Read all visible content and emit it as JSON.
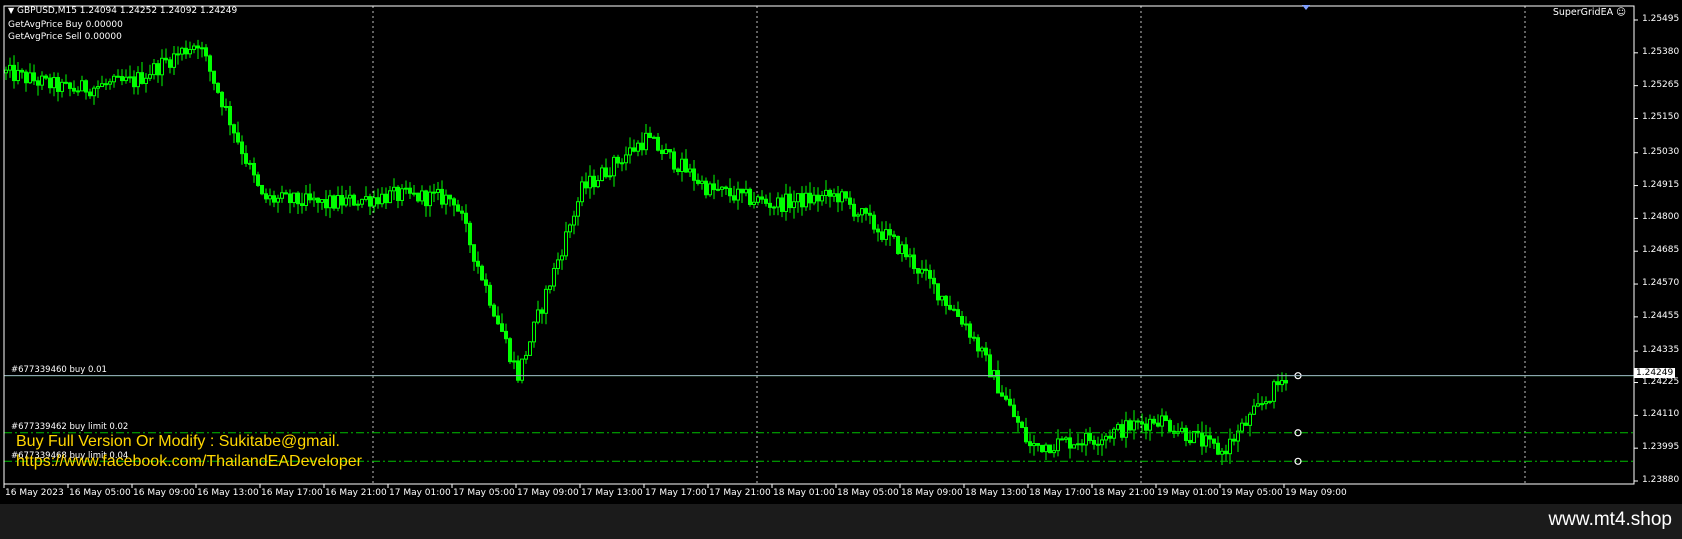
{
  "chart": {
    "symbol_line": "GBPUSD,M15  1.24094 1.24252 1.24092 1.24249",
    "indicators": [
      {
        "label": "GetAvgPrice Buy  0.00000"
      },
      {
        "label": "GetAvgPrice Sell  0.00000"
      }
    ],
    "ea_name": "SuperGridEA",
    "smiley": "☺",
    "promo_line_1": "Buy Full Version Or Modify : Sukitabe@gmail.",
    "promo_line_2": "https://www.facebook.com/ThailandEADeveloper",
    "orders": [
      {
        "label": "#677339460 buy 0.01",
        "price": 1.24249,
        "style": "solid"
      },
      {
        "label": "#677339462 buy limit 0.02",
        "price": 1.24049,
        "style": "dashdot"
      },
      {
        "label": "#677339468 buy limit 0.04",
        "price": 1.23949,
        "style": "dashdot"
      }
    ],
    "current_price": "1.24249",
    "price_axis": [
      "1.25495",
      "1.25380",
      "1.25265",
      "1.25150",
      "1.25030",
      "1.24915",
      "1.24800",
      "1.24685",
      "1.24570",
      "1.24455",
      "1.24335",
      "1.24225",
      "1.24110",
      "1.23995",
      "1.23880"
    ],
    "time_axis": [
      "16 May 2023",
      "16 May 05:00",
      "16 May 09:00",
      "16 May 13:00",
      "16 May 17:00",
      "16 May 21:00",
      "17 May 01:00",
      "17 May 05:00",
      "17 May 09:00",
      "17 May 13:00",
      "17 May 17:00",
      "17 May 21:00",
      "18 May 01:00",
      "18 May 05:00",
      "18 May 09:00",
      "18 May 13:00",
      "18 May 17:00",
      "18 May 21:00",
      "19 May 01:00",
      "19 May 05:00",
      "19 May 09:00"
    ],
    "colors": {
      "candle": "#00ff00",
      "order_line": "#00c000",
      "grid": "#c0c0c0",
      "promo": "#ffd700"
    }
  },
  "chart_data": {
    "type": "line",
    "ylim": [
      1.2385,
      1.2557
    ],
    "x": [
      "16 May 2023",
      "16 May 05:00",
      "16 May 09:00",
      "16 May 13:00",
      "16 May 17:00",
      "16 May 21:00",
      "17 May 01:00",
      "17 May 05:00",
      "17 May 09:00",
      "17 May 13:00",
      "17 May 17:00",
      "17 May 21:00",
      "18 May 01:00",
      "18 May 05:00",
      "18 May 09:00",
      "18 May 13:00",
      "18 May 17:00",
      "18 May 21:00",
      "19 May 01:00",
      "19 May 05:00",
      "19 May 09:00"
    ],
    "series": [
      {
        "values": [
          1.2531,
          1.2525,
          1.2528,
          1.2542,
          1.2487,
          1.2485,
          1.2488,
          1.2487,
          1.2425,
          1.249,
          1.2508,
          1.249,
          1.2485,
          1.2488,
          1.2469,
          1.2443,
          1.24,
          1.2403,
          1.241,
          1.2398,
          1.2425
        ]
      }
    ]
  },
  "footer": {
    "watermark": "www.mt4.shop"
  }
}
